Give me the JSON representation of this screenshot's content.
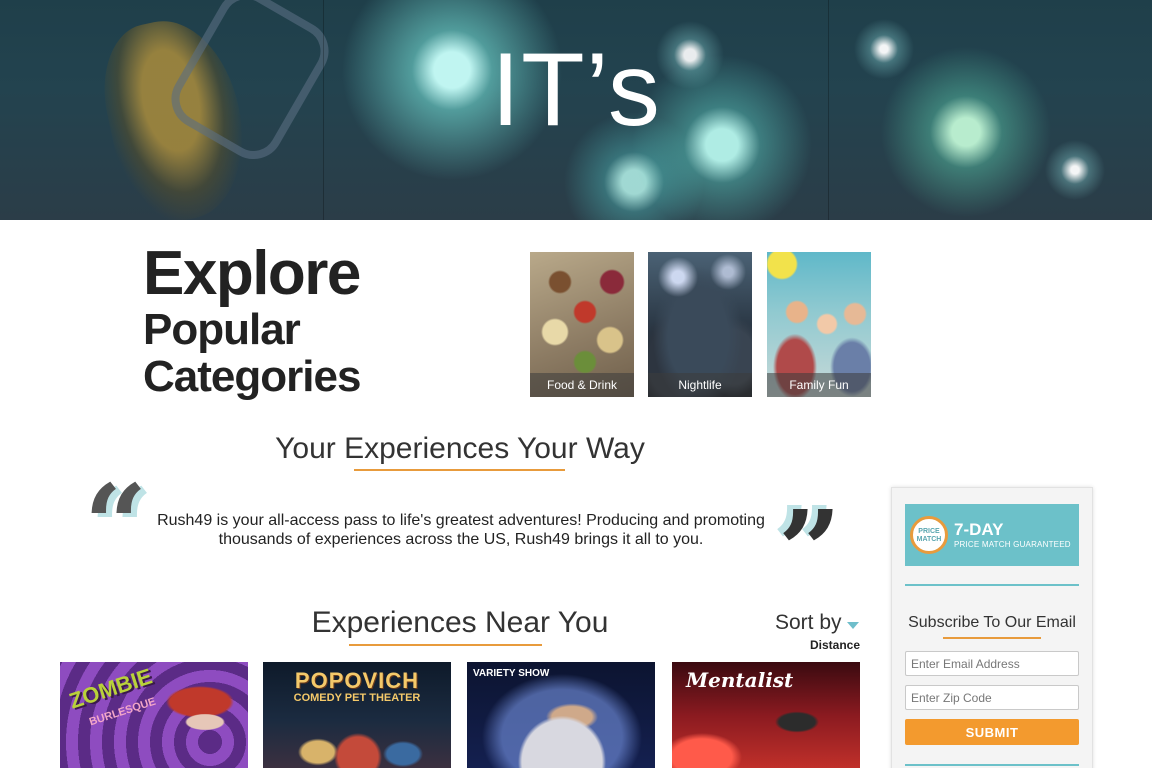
{
  "hero": {
    "title": "IT’s"
  },
  "explore": {
    "line1": "Explore",
    "line2": "Popular",
    "line3": "Categories"
  },
  "categories": [
    {
      "label": "Food & Drink"
    },
    {
      "label": "Nightlife"
    },
    {
      "label": "Family Fun"
    }
  ],
  "experiences_heading": "Your Experiences Your Way",
  "quote": "Rush49 is your all-access pass to life's greatest adventures! Producing and promoting thousands of experiences across the US, Rush49 brings it all to you.",
  "near_you": {
    "heading": "Experiences Near You",
    "sort_label": "Sort by",
    "sort_value": "Distance",
    "cards": [
      {
        "title": "ZOMBIE",
        "subtitle": "BURLESQUE"
      },
      {
        "title": "POPOVICH",
        "subtitle": "COMEDY PET THEATER"
      },
      {
        "title": "VARIETY SHOW"
      },
      {
        "title": "Mentalist"
      }
    ]
  },
  "sidebar": {
    "badge_text": "PRICE MATCH",
    "price_title": "7-DAY",
    "price_subtitle": "PRICE MATCH GUARANTEED",
    "subscribe_title": "Subscribe To Our Email",
    "email_placeholder": "Enter Email Address",
    "zip_placeholder": "Enter Zip Code",
    "submit_label": "SUBMIT"
  },
  "colors": {
    "accent_orange": "#e89b3c",
    "accent_teal": "#6cc1c9",
    "submit_orange": "#f39a2e"
  }
}
